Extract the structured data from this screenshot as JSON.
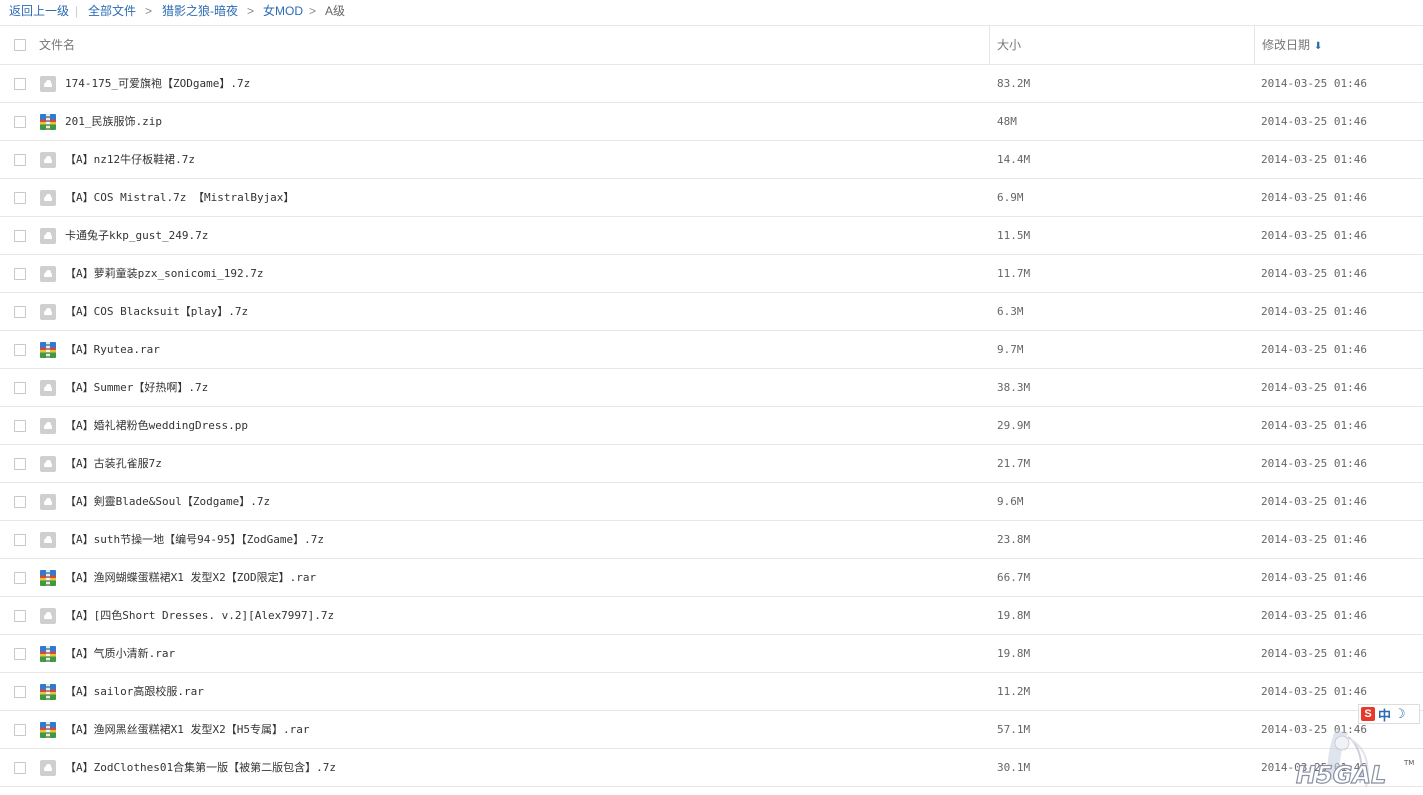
{
  "breadcrumb": {
    "back": "返回上一级",
    "separator": "|",
    "arrow": ">",
    "items": [
      "全部文件",
      "猎影之狼-暗夜",
      "女MOD",
      "A级"
    ]
  },
  "header": {
    "name": "文件名",
    "size": "大小",
    "date": "修改日期",
    "sort_icon": "arrow-down-icon",
    "sort_glyph": "⬇"
  },
  "files": [
    {
      "name": "174-175_可爱旗袍【ZODgame】.7z",
      "size": "83.2M",
      "date": "2014-03-25 01:46",
      "icon": "file-generic-icon"
    },
    {
      "name": "201_民族服饰.zip",
      "size": "48M",
      "date": "2014-03-25 01:46",
      "icon": "archive-icon"
    },
    {
      "name": "【A】nz12牛仔板鞋裙.7z",
      "size": "14.4M",
      "date": "2014-03-25 01:46",
      "icon": "file-generic-icon"
    },
    {
      "name": "【A】COS Mistral.7z 【MistralByjax】",
      "size": "6.9M",
      "date": "2014-03-25 01:46",
      "icon": "file-generic-icon"
    },
    {
      "name": "卡通兔子kkp_gust_249.7z",
      "size": "11.5M",
      "date": "2014-03-25 01:46",
      "icon": "file-generic-icon"
    },
    {
      "name": "【A】萝莉童装pzx_sonicomi_192.7z",
      "size": "11.7M",
      "date": "2014-03-25 01:46",
      "icon": "file-generic-icon"
    },
    {
      "name": "【A】COS Blacksuit【play】.7z",
      "size": "6.3M",
      "date": "2014-03-25 01:46",
      "icon": "file-generic-icon"
    },
    {
      "name": "【A】Ryutea.rar",
      "size": "9.7M",
      "date": "2014-03-25 01:46",
      "icon": "archive-icon"
    },
    {
      "name": "【A】Summer【好热啊】.7z",
      "size": "38.3M",
      "date": "2014-03-25 01:46",
      "icon": "file-generic-icon"
    },
    {
      "name": "【A】婚礼裙粉色weddingDress.pp",
      "size": "29.9M",
      "date": "2014-03-25 01:46",
      "icon": "file-generic-icon"
    },
    {
      "name": "【A】古装孔雀服7z",
      "size": "21.7M",
      "date": "2014-03-25 01:46",
      "icon": "file-generic-icon"
    },
    {
      "name": "【A】剣靈Blade&Soul【Zodgame】.7z",
      "size": "9.6M",
      "date": "2014-03-25 01:46",
      "icon": "file-generic-icon"
    },
    {
      "name": "【A】suth节操一地【编号94-95】【ZodGame】.7z",
      "size": "23.8M",
      "date": "2014-03-25 01:46",
      "icon": "file-generic-icon"
    },
    {
      "name": "【A】渔网蝴蝶蛋糕裙X1 发型X2【ZOD限定】.rar",
      "size": "66.7M",
      "date": "2014-03-25 01:46",
      "icon": "archive-icon"
    },
    {
      "name": "【A】[四色Short Dresses. v.2][Alex7997].7z",
      "size": "19.8M",
      "date": "2014-03-25 01:46",
      "icon": "file-generic-icon"
    },
    {
      "name": "【A】气质小清新.rar",
      "size": "19.8M",
      "date": "2014-03-25 01:46",
      "icon": "archive-icon"
    },
    {
      "name": "【A】sailor高跟校服.rar",
      "size": "11.2M",
      "date": "2014-03-25 01:46",
      "icon": "archive-icon"
    },
    {
      "name": "【A】渔网黑丝蛋糕裙X1 发型X2【H5专属】.rar",
      "size": "57.1M",
      "date": "2014-03-25 01:46",
      "icon": "archive-icon"
    },
    {
      "name": "【A】ZodClothes01合集第一版【被第二版包含】.7z",
      "size": "30.1M",
      "date": "2014-03-25 01:46",
      "icon": "file-generic-icon"
    }
  ],
  "ime": {
    "logo": "S",
    "mode": "中",
    "moon": "☽"
  },
  "watermark": {
    "text": "H5GAL",
    "tm": "TM"
  },
  "colors": {
    "link": "#2b6bb3",
    "border": "#e6e6e6"
  }
}
